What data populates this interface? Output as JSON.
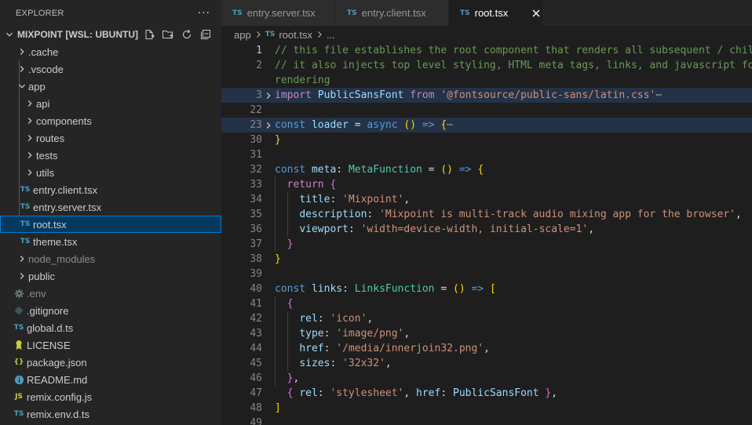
{
  "explorer": {
    "title": "EXPLORER",
    "more": "···",
    "workspace": "MIXPOINT [WSL: UBUNTU]",
    "items": [
      {
        "label": ".cache",
        "kind": "folder",
        "depth": 0,
        "state": "collapsed"
      },
      {
        "label": ".vscode",
        "kind": "folder",
        "depth": 0,
        "state": "collapsed"
      },
      {
        "label": "app",
        "kind": "folder",
        "depth": 0,
        "state": "expanded"
      },
      {
        "label": "api",
        "kind": "folder",
        "depth": 1,
        "state": "collapsed"
      },
      {
        "label": "components",
        "kind": "folder",
        "depth": 1,
        "state": "collapsed"
      },
      {
        "label": "routes",
        "kind": "folder",
        "depth": 1,
        "state": "collapsed"
      },
      {
        "label": "tests",
        "kind": "folder",
        "depth": 1,
        "state": "collapsed"
      },
      {
        "label": "utils",
        "kind": "folder",
        "depth": 1,
        "state": "collapsed"
      },
      {
        "label": "entry.client.tsx",
        "kind": "ts",
        "depth": 1,
        "badge": "TS"
      },
      {
        "label": "entry.server.tsx",
        "kind": "ts",
        "depth": 1,
        "badge": "TS"
      },
      {
        "label": "root.tsx",
        "kind": "ts",
        "depth": 1,
        "badge": "TS",
        "selected": true
      },
      {
        "label": "theme.tsx",
        "kind": "ts",
        "depth": 1,
        "badge": "TS"
      },
      {
        "label": "node_modules",
        "kind": "folder",
        "depth": 0,
        "state": "collapsed",
        "dim": true
      },
      {
        "label": "public",
        "kind": "folder",
        "depth": 0,
        "state": "collapsed"
      },
      {
        "label": ".env",
        "kind": "gear",
        "depth": 0,
        "dim": true
      },
      {
        "label": ".gitignore",
        "kind": "git",
        "depth": 0
      },
      {
        "label": "global.d.ts",
        "kind": "ts",
        "depth": 0,
        "badge": "TS"
      },
      {
        "label": "LICENSE",
        "kind": "license",
        "depth": 0
      },
      {
        "label": "package.json",
        "kind": "json",
        "depth": 0,
        "badge": "{}"
      },
      {
        "label": "README.md",
        "kind": "info",
        "depth": 0
      },
      {
        "label": "remix.config.js",
        "kind": "js",
        "depth": 0,
        "badge": "JS"
      },
      {
        "label": "remix.env.d.ts",
        "kind": "ts",
        "depth": 0,
        "badge": "TS"
      }
    ]
  },
  "tabs": [
    {
      "label": "entry.server.tsx",
      "badge": "TS",
      "active": false
    },
    {
      "label": "entry.client.tsx",
      "badge": "TS",
      "active": false
    },
    {
      "label": "root.tsx",
      "badge": "TS",
      "active": true
    }
  ],
  "breadcrumb": {
    "folder": "app",
    "file": "root.tsx",
    "badge": "TS",
    "more": "..."
  },
  "colors": {
    "accent": "#007fd4",
    "selection": "#04395e",
    "ts_badge": "#519aba",
    "js_badge": "#cbcb41",
    "json_badge": "#cbcb41",
    "license_icon": "#cbcb41",
    "info_icon": "#519aba",
    "gitignore_icon": "#41535b",
    "env_icon": "#6d8086"
  },
  "editor": {
    "lines": [
      {
        "n": "1",
        "current": true,
        "tokens": [
          [
            "c-com",
            "// this file establishes the root component that renders all subsequent / child routes"
          ]
        ]
      },
      {
        "n": "2",
        "tokens": [
          [
            "c-com",
            "// it also injects top level styling, HTML meta tags, links, and javascript for browser"
          ]
        ]
      },
      {
        "n": "",
        "tokens": [
          [
            "c-com",
            "rendering"
          ]
        ]
      },
      {
        "n": "3",
        "fold": true,
        "bg": "hl-fold",
        "tokens": [
          [
            "c-ctl",
            "import"
          ],
          [
            "c-pun",
            " "
          ],
          [
            "c-var",
            "PublicSansFont"
          ],
          [
            "c-pun",
            " "
          ],
          [
            "c-ctl",
            "from"
          ],
          [
            "c-pun",
            " "
          ],
          [
            "c-str",
            "'@fontsource/public-sans/latin.css'"
          ],
          [
            "c-dots",
            "⋯"
          ]
        ]
      },
      {
        "n": "22",
        "tokens": []
      },
      {
        "n": "23",
        "fold": true,
        "bg": "hl-fold",
        "tokens": [
          [
            "c-kw",
            "const"
          ],
          [
            "c-pun",
            " "
          ],
          [
            "c-var",
            "loader"
          ],
          [
            "c-pun",
            " = "
          ],
          [
            "c-kw",
            "async"
          ],
          [
            "c-pun",
            " "
          ],
          [
            "c-br1",
            "()"
          ],
          [
            "c-pun",
            " "
          ],
          [
            "c-kw",
            "=>"
          ],
          [
            "c-pun",
            " "
          ],
          [
            "c-br1",
            "{"
          ],
          [
            "c-dots",
            "⋯"
          ]
        ]
      },
      {
        "n": "30",
        "tokens": [
          [
            "c-br1",
            "}"
          ]
        ]
      },
      {
        "n": "31",
        "tokens": []
      },
      {
        "n": "32",
        "tokens": [
          [
            "c-kw",
            "const"
          ],
          [
            "c-pun",
            " "
          ],
          [
            "c-var",
            "meta"
          ],
          [
            "c-pun",
            ": "
          ],
          [
            "c-type",
            "MetaFunction"
          ],
          [
            "c-pun",
            " = "
          ],
          [
            "c-br1",
            "()"
          ],
          [
            "c-pun",
            " "
          ],
          [
            "c-kw",
            "=>"
          ],
          [
            "c-pun",
            " "
          ],
          [
            "c-br1",
            "{"
          ]
        ]
      },
      {
        "n": "33",
        "tokens": [
          [
            "c-pun",
            "  "
          ],
          [
            "c-ctl",
            "return"
          ],
          [
            "c-pun",
            " "
          ],
          [
            "c-br2",
            "{"
          ]
        ]
      },
      {
        "n": "34",
        "tokens": [
          [
            "c-pun",
            "    "
          ],
          [
            "c-var",
            "title"
          ],
          [
            "c-pun",
            ": "
          ],
          [
            "c-str",
            "'Mixpoint'"
          ],
          [
            "c-pun",
            ","
          ]
        ]
      },
      {
        "n": "35",
        "tokens": [
          [
            "c-pun",
            "    "
          ],
          [
            "c-var",
            "description"
          ],
          [
            "c-pun",
            ": "
          ],
          [
            "c-str",
            "'Mixpoint is multi-track audio mixing app for the browser'"
          ],
          [
            "c-pun",
            ","
          ]
        ]
      },
      {
        "n": "36",
        "tokens": [
          [
            "c-pun",
            "    "
          ],
          [
            "c-var",
            "viewport"
          ],
          [
            "c-pun",
            ": "
          ],
          [
            "c-str",
            "'width=device-width, initial-scale=1'"
          ],
          [
            "c-pun",
            ","
          ]
        ]
      },
      {
        "n": "37",
        "tokens": [
          [
            "c-pun",
            "  "
          ],
          [
            "c-br2",
            "}"
          ]
        ]
      },
      {
        "n": "38",
        "tokens": [
          [
            "c-br1",
            "}"
          ]
        ]
      },
      {
        "n": "39",
        "tokens": []
      },
      {
        "n": "40",
        "tokens": [
          [
            "c-kw",
            "const"
          ],
          [
            "c-pun",
            " "
          ],
          [
            "c-var",
            "links"
          ],
          [
            "c-pun",
            ": "
          ],
          [
            "c-type",
            "LinksFunction"
          ],
          [
            "c-pun",
            " = "
          ],
          [
            "c-br1",
            "()"
          ],
          [
            "c-pun",
            " "
          ],
          [
            "c-kw",
            "=>"
          ],
          [
            "c-pun",
            " "
          ],
          [
            "c-br1",
            "["
          ]
        ]
      },
      {
        "n": "41",
        "tokens": [
          [
            "c-pun",
            "  "
          ],
          [
            "c-br2",
            "{"
          ]
        ]
      },
      {
        "n": "42",
        "tokens": [
          [
            "c-pun",
            "    "
          ],
          [
            "c-var",
            "rel"
          ],
          [
            "c-pun",
            ": "
          ],
          [
            "c-str",
            "'icon'"
          ],
          [
            "c-pun",
            ","
          ]
        ]
      },
      {
        "n": "43",
        "tokens": [
          [
            "c-pun",
            "    "
          ],
          [
            "c-var",
            "type"
          ],
          [
            "c-pun",
            ": "
          ],
          [
            "c-str",
            "'image/png'"
          ],
          [
            "c-pun",
            ","
          ]
        ]
      },
      {
        "n": "44",
        "tokens": [
          [
            "c-pun",
            "    "
          ],
          [
            "c-var",
            "href"
          ],
          [
            "c-pun",
            ": "
          ],
          [
            "c-str",
            "'/media/innerjoin32.png'"
          ],
          [
            "c-pun",
            ","
          ]
        ]
      },
      {
        "n": "45",
        "tokens": [
          [
            "c-pun",
            "    "
          ],
          [
            "c-var",
            "sizes"
          ],
          [
            "c-pun",
            ": "
          ],
          [
            "c-str",
            "'32x32'"
          ],
          [
            "c-pun",
            ","
          ]
        ]
      },
      {
        "n": "46",
        "tokens": [
          [
            "c-pun",
            "  "
          ],
          [
            "c-br2",
            "}"
          ],
          [
            "c-pun",
            ","
          ]
        ]
      },
      {
        "n": "47",
        "tokens": [
          [
            "c-pun",
            "  "
          ],
          [
            "c-br2",
            "{"
          ],
          [
            "c-pun",
            " "
          ],
          [
            "c-var",
            "rel"
          ],
          [
            "c-pun",
            ": "
          ],
          [
            "c-str",
            "'stylesheet'"
          ],
          [
            "c-pun",
            ", "
          ],
          [
            "c-var",
            "href"
          ],
          [
            "c-pun",
            ": "
          ],
          [
            "c-var",
            "PublicSansFont"
          ],
          [
            "c-pun",
            " "
          ],
          [
            "c-br2",
            "}"
          ],
          [
            "c-pun",
            ","
          ]
        ]
      },
      {
        "n": "48",
        "tokens": [
          [
            "c-br1",
            "]"
          ]
        ]
      },
      {
        "n": "49",
        "tokens": []
      }
    ]
  }
}
